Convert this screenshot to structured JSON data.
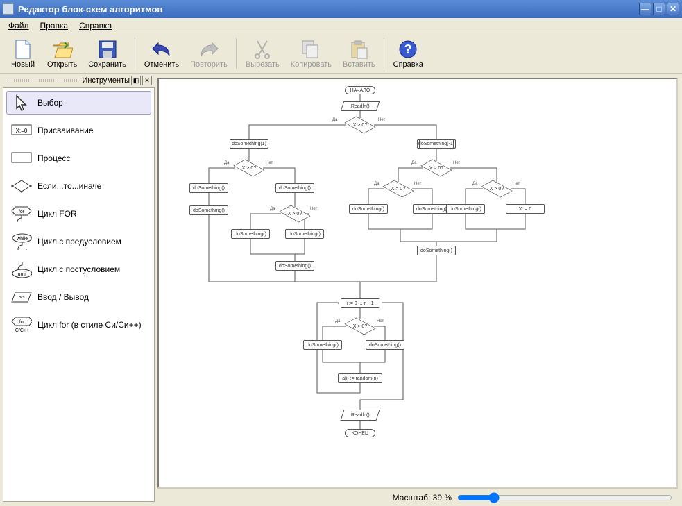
{
  "title": "Редактор блок-схем алгоритмов",
  "window_controls": {
    "minimize": "—",
    "maximize": "□",
    "close": "✕"
  },
  "menu": {
    "file": "Файл",
    "edit": "Правка",
    "help": "Справка"
  },
  "toolbar": {
    "new": "Новый",
    "open": "Открыть",
    "save": "Сохранить",
    "undo": "Отменить",
    "redo": "Повторить",
    "cut": "Вырезать",
    "copy": "Копировать",
    "paste": "Вставить",
    "help": "Справка"
  },
  "panel": {
    "title": "Инструменты",
    "items": {
      "select": "Выбор",
      "assign": "Присваивание",
      "process": "Процесс",
      "ifelse": "Если...то...иначе",
      "for": "Цикл FOR",
      "while": "Цикл с предусловием",
      "until": "Цикл с постусловием",
      "io": "Ввод / Вывод",
      "forc": "Цикл for (в стиле Си/Си++)"
    }
  },
  "flow": {
    "start": "НАЧАЛО",
    "end": "КОНЕЦ",
    "readln": "Readln()",
    "cond": "X > 0?",
    "yes": "Да",
    "no": "Нет",
    "do1": "doSomething(1)",
    "dom1": "doSomething(-1)",
    "do": "doSomething()",
    "xzero": "X := 0",
    "ito": "i := 0 ... n - 1",
    "arr": "a[i] := random(n)"
  },
  "status": {
    "zoom_label": "Масштаб: 39 %",
    "zoom_value": 39,
    "zoom_min": 10,
    "zoom_max": 200
  }
}
